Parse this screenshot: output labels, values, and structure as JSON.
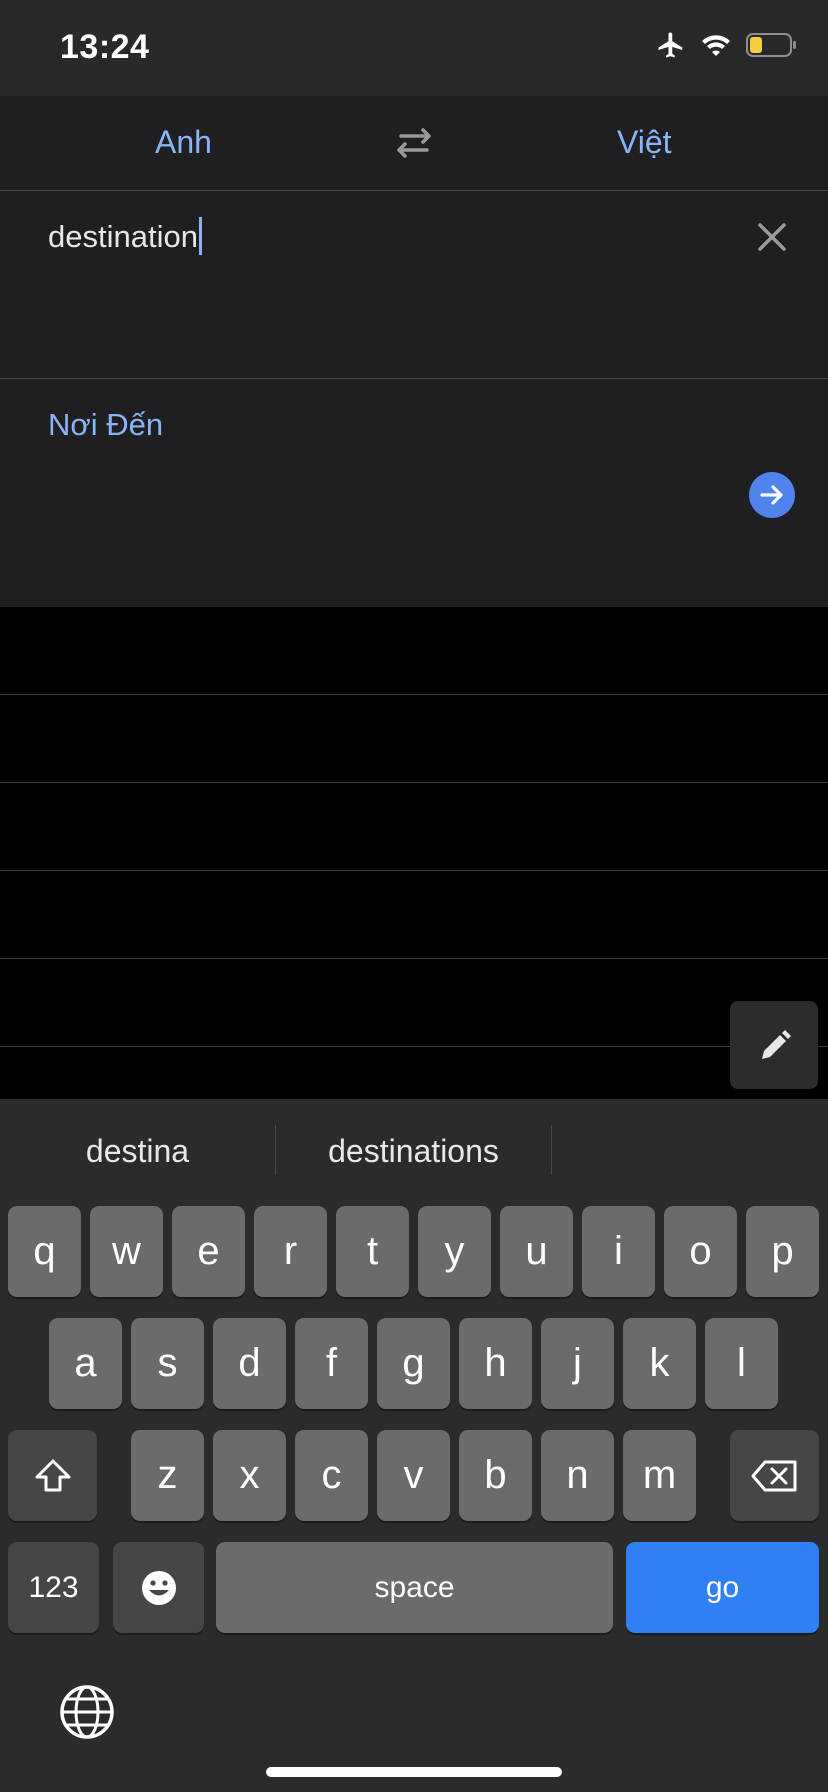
{
  "status_bar": {
    "time": "13:24",
    "icons": [
      "airplane-icon",
      "wifi-icon",
      "battery-icon"
    ],
    "battery_color": "#f4d03f"
  },
  "languages": {
    "source": "Anh",
    "target": "Việt",
    "swap_icon": "swap-icon"
  },
  "input": {
    "text": "destination",
    "clear_icon": "close-icon"
  },
  "result": {
    "text": "Nơi Đến",
    "action_icon": "arrow-right-icon"
  },
  "history_rows": [
    "",
    "",
    "",
    "",
    ""
  ],
  "tools": {
    "handwriting_icon": "pen-icon"
  },
  "keyboard": {
    "suggestions": [
      "destina",
      "destinations",
      ""
    ],
    "row1": [
      "q",
      "w",
      "e",
      "r",
      "t",
      "y",
      "u",
      "i",
      "o",
      "p"
    ],
    "row2": [
      "a",
      "s",
      "d",
      "f",
      "g",
      "h",
      "j",
      "k",
      "l"
    ],
    "row3": [
      "z",
      "x",
      "c",
      "v",
      "b",
      "n",
      "m"
    ],
    "shift_icon": "shift-icon",
    "delete_icon": "backspace-icon",
    "numbers_label": "123",
    "emoji_icon": "emoji-icon",
    "space_label": "space",
    "go_label": "go",
    "globe_icon": "globe-icon"
  },
  "colors": {
    "accent": "#8ab4f8",
    "go_key": "#2f7ff5",
    "arrow_button": "#4f83ee"
  }
}
